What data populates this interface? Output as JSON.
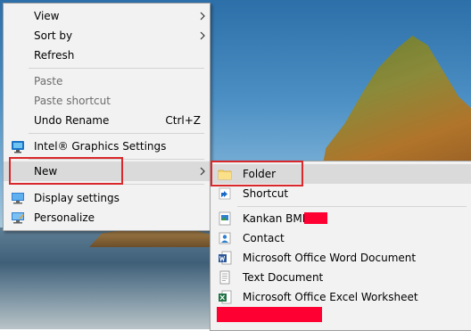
{
  "context_menu": {
    "items": [
      {
        "label": "View"
      },
      {
        "label": "Sort by"
      },
      {
        "label": "Refresh"
      },
      {
        "label": "Paste"
      },
      {
        "label": "Paste shortcut"
      },
      {
        "label": "Undo Rename",
        "shortcut": "Ctrl+Z"
      },
      {
        "label": "Intel® Graphics Settings",
        "icon": "intel-graphics-icon"
      },
      {
        "label": "New"
      },
      {
        "label": "Display settings",
        "icon": "display-icon"
      },
      {
        "label": "Personalize",
        "icon": "personalize-icon"
      }
    ]
  },
  "new_submenu": {
    "items": [
      {
        "label": "Folder",
        "icon": "folder-icon"
      },
      {
        "label": "Shortcut",
        "icon": "shortcut-icon"
      },
      {
        "label": "Kankan BMP",
        "icon": "bmp-image-icon"
      },
      {
        "label": "Contact",
        "icon": "contact-icon"
      },
      {
        "label": "Microsoft Office Word Document",
        "icon": "word-document-icon"
      },
      {
        "label": "Text Document",
        "icon": "text-document-icon"
      },
      {
        "label": "Microsoft Office Excel Worksheet",
        "icon": "excel-worksheet-icon"
      }
    ]
  },
  "colors": {
    "highlight_box": "#d9282b",
    "redaction": "#ff0033",
    "menu_background": "#f2f2f2"
  }
}
